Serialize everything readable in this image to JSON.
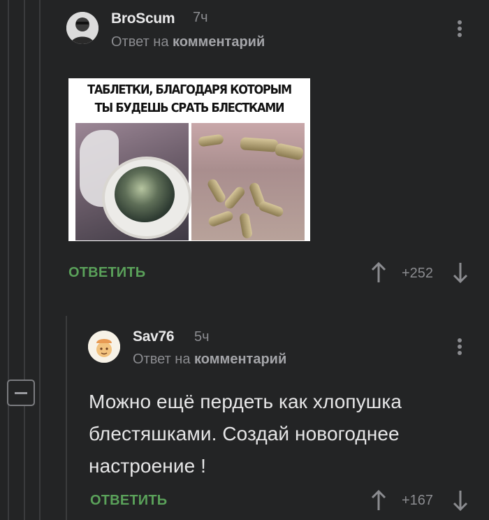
{
  "comments": [
    {
      "username": "BroScum",
      "time": "7ч",
      "reply_prefix": "Ответ на",
      "reply_target": "комментарий",
      "image_caption_line1": "ТАБЛЕТКИ, БЛАГОДАРЯ КОТОРЫМ",
      "image_caption_line2": "ТЫ БУДЕШЬ СРАТЬ БЛЕСТКАМИ",
      "reply_label": "ОТВЕТИТЬ",
      "score": "+252"
    },
    {
      "username": "Sav76",
      "time": "5ч",
      "reply_prefix": "Ответ на",
      "reply_target": "комментарий",
      "text_line1": "Можно ещё пердеть как хлопушка",
      "text_line2": "блестяшками. Создай новогоднее",
      "text_line3": "настроение !",
      "reply_label": "ОТВЕТИТЬ",
      "score": "+167"
    }
  ],
  "icons": {
    "upvote": "arrow-up-icon",
    "downvote": "arrow-down-icon",
    "more": "kebab-menu-icon",
    "collapse": "collapse-minus-icon"
  },
  "colors": {
    "background": "#232425",
    "reply_button": "#5aa15a",
    "muted_text": "#8b8c90"
  }
}
